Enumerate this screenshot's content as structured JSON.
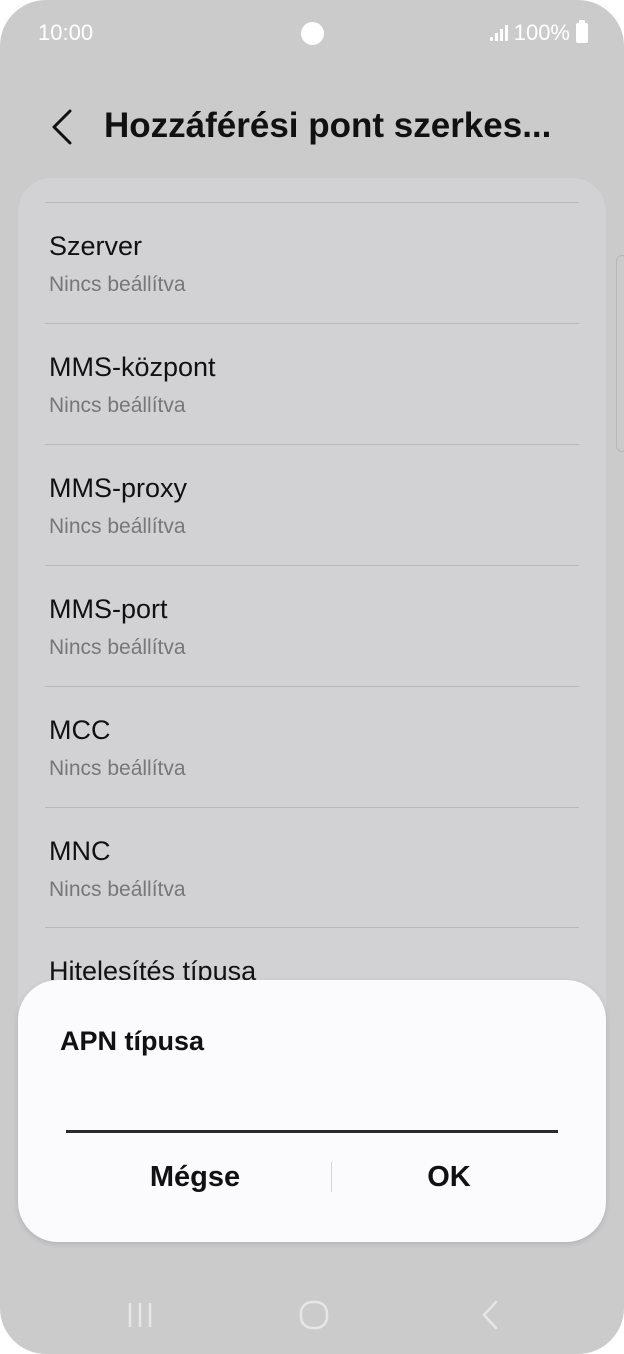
{
  "status_bar": {
    "time": "10:00",
    "battery_text": "100%"
  },
  "app_bar": {
    "title": "Hozzáférési pont szerkes..."
  },
  "settings": [
    {
      "title": "Szerver",
      "value": "Nincs beállítva"
    },
    {
      "title": "MMS-központ",
      "value": "Nincs beállítva"
    },
    {
      "title": "MMS-proxy",
      "value": "Nincs beállítva"
    },
    {
      "title": "MMS-port",
      "value": "Nincs beállítva"
    },
    {
      "title": "MCC",
      "value": "Nincs beállítva"
    },
    {
      "title": "MNC",
      "value": "Nincs beállítva"
    },
    {
      "title": "Hitelesítés típusa",
      "value": ""
    }
  ],
  "dialog": {
    "title": "APN típusa",
    "input_value": "",
    "cancel_label": "Mégse",
    "ok_label": "OK"
  },
  "icons": [
    "back-chevron-icon",
    "signal-icon",
    "battery-icon",
    "recents-icon",
    "home-icon",
    "nav-back-icon"
  ],
  "colors": {
    "background_dimmed": "#cbcbcc",
    "card": "#d2d2d4",
    "dialog": "#fbfbfe",
    "text_primary": "#111111",
    "text_secondary": "#77777a"
  }
}
